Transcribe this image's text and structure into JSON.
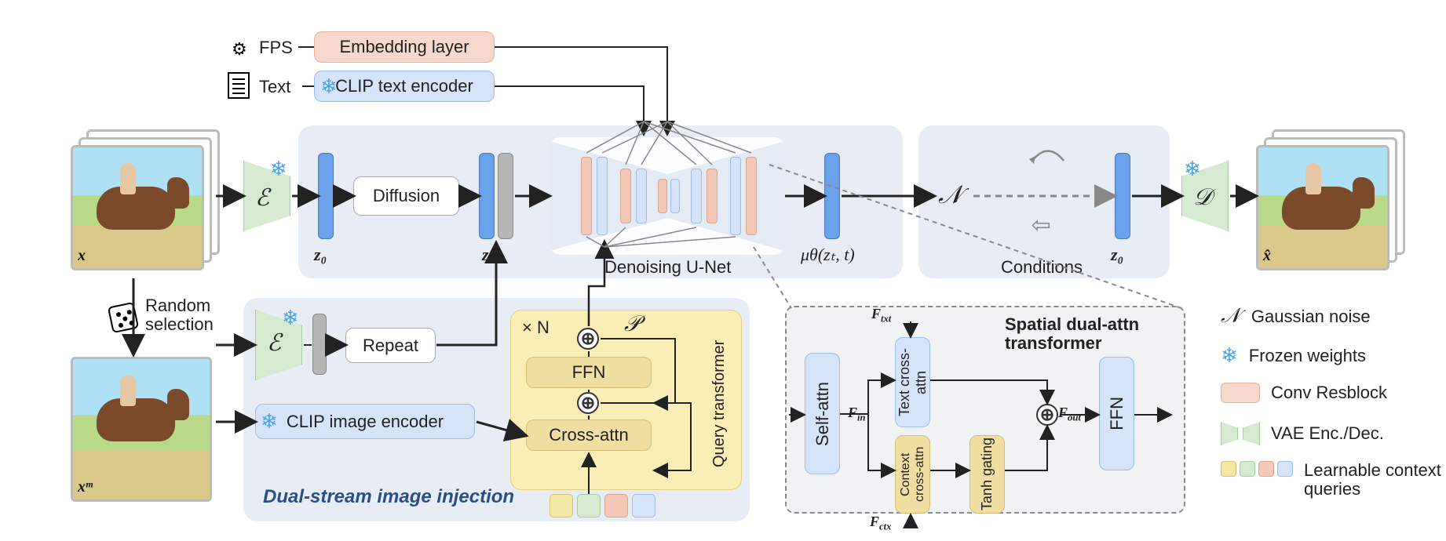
{
  "inputs": {
    "x_label": "x",
    "xm_label": "xᵐ",
    "xhat_label": "x̂",
    "fps_label": "FPS",
    "text_label": "Text",
    "random_selection": "Random selection"
  },
  "top_blocks": {
    "embedding_layer": "Embedding layer",
    "clip_text_encoder": "CLIP text encoder"
  },
  "main": {
    "diffusion": "Diffusion",
    "denoising_unet": "Denoising U-Net",
    "z0": "z₀",
    "zt": "zₜ",
    "mu": "μθ(zₜ, t)",
    "noise_N": "𝒩",
    "conditions": "Conditions",
    "z0_right": "z₀"
  },
  "enc_dec": {
    "enc_E": "ℰ",
    "dec_D": "𝒟"
  },
  "dual_stream": {
    "title": "Dual-stream image injection",
    "repeat": "Repeat",
    "clip_image_encoder": "CLIP image encoder",
    "times_N": "× N",
    "P": "𝒫",
    "ffn": "FFN",
    "cross_attn": "Cross-attn",
    "query_transformer": "Query transformer"
  },
  "spatial": {
    "title": "Spatial dual-attn transformer",
    "self_attn": "Self-attn",
    "text_cross_attn": "Text cross-attn",
    "context_cross_attn": "Context cross-attn",
    "tanh_gating": "Tanh gating",
    "ffn": "FFN",
    "F_txt": "F_txt",
    "F_in": "F_in",
    "F_ctx": "F_ctx",
    "F_out": "F_out"
  },
  "legend": {
    "gaussian_noise": "Gaussian noise",
    "frozen_weights": "Frozen weights",
    "conv_resblock": "Conv Resblock",
    "vae_enc_dec": "VAE Enc./Dec.",
    "learnable_queries": "Learnable context queries",
    "N_symbol": "𝒩",
    "snow_symbol": "❄"
  }
}
